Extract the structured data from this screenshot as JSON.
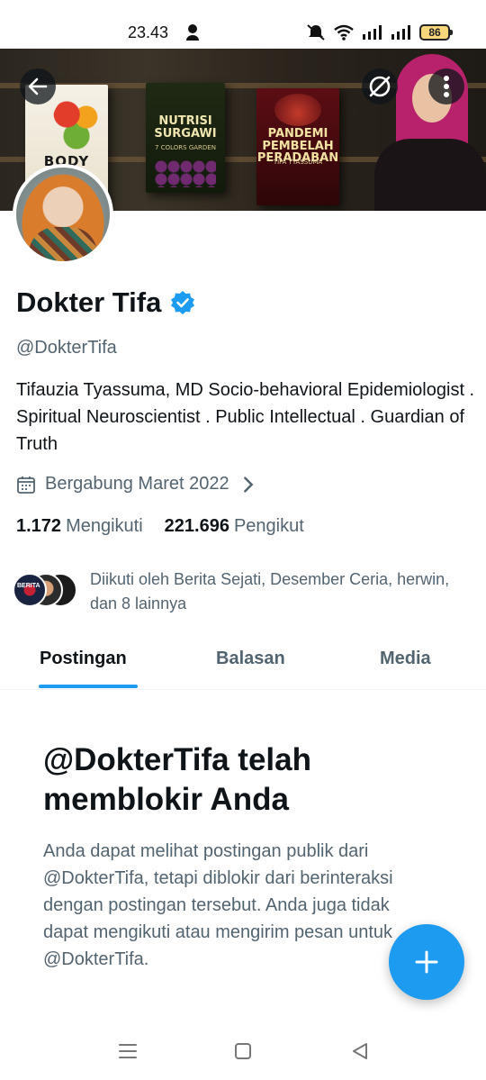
{
  "status_bar": {
    "time": "23.43",
    "battery_level": "86"
  },
  "banner": {
    "book1_title": "BODY REVO LUTI",
    "book2_title": "NUTRISI SURGAWI",
    "book2_subtitle": "7 COLORS GARDEN",
    "book3_title": "PANDEMI PEMBELAH PERADABAN",
    "book3_author": "TIFA TYASSUMA"
  },
  "profile": {
    "name": "Dokter Tifa",
    "handle": "@DokterTifa",
    "bio": "Tifauzia Tyassuma, MD Socio-behavioral Epidemiologist .  Spiritual Neuroscientist . Public Intellectual . Guardian of Truth",
    "joined": "Bergabung Maret 2022",
    "following_count": "1.172",
    "following_label": "Mengikuti",
    "followers_count": "221.696",
    "followers_label": "Pengikut",
    "followed_by": "Diikuti oleh Berita Sejati, Desember Ceria, herwin, dan 8 lainnya",
    "mini_avatar_badge": "BERITA"
  },
  "tabs": [
    {
      "label": "Postingan",
      "active": true
    },
    {
      "label": "Balasan",
      "active": false
    },
    {
      "label": "Media",
      "active": false
    }
  ],
  "blocked": {
    "title": "@DokterTifa telah memblokir Anda",
    "body": "Anda dapat melihat postingan publik dari @DokterTifa, tetapi diblokir dari berinteraksi dengan postingan tersebut. Anda juga tidak dapat mengikuti atau mengirim pesan untuk @DokterTifa."
  },
  "colors": {
    "accent": "#1d9bf0",
    "text_primary": "#0f1419",
    "text_secondary": "#536471"
  },
  "icons": {
    "back": "arrow-left-icon",
    "grok": "grok-icon",
    "more": "more-vertical-icon",
    "verified": "verified-badge-icon",
    "calendar": "calendar-icon",
    "chevron": "chevron-right-icon",
    "compose": "plus-icon"
  }
}
